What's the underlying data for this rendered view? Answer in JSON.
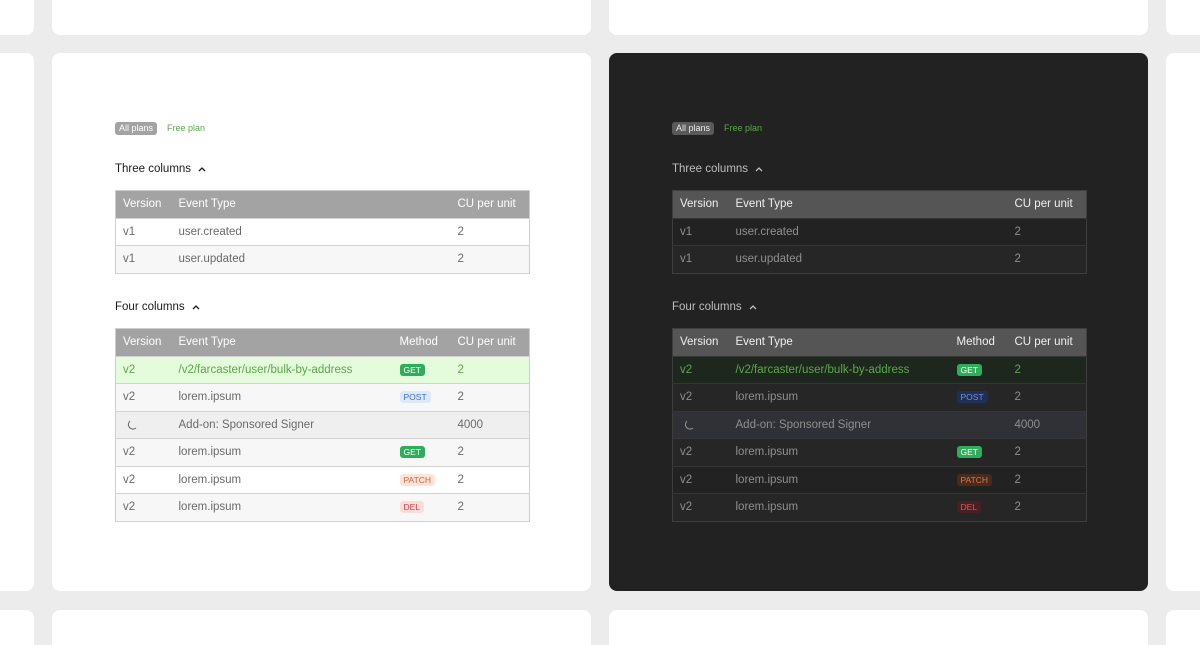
{
  "panels": [
    {
      "theme": "light",
      "tags": {
        "all_plans": "All plans",
        "free_plan": "Free plan"
      },
      "three_columns": {
        "title": "Three columns",
        "headers": [
          "Version",
          "Event Type",
          "CU per unit"
        ],
        "rows": [
          {
            "version": "v1",
            "event": "user.created",
            "cu": "2"
          },
          {
            "version": "v1",
            "event": "user.updated",
            "cu": "2"
          }
        ]
      },
      "four_columns": {
        "title": "Four columns",
        "headers": [
          "Version",
          "Event Type",
          "Method",
          "CU per unit"
        ],
        "rows": [
          {
            "version": "v2",
            "event": "/v2/farcaster/user/bulk-by-address",
            "method": "GET",
            "cu": "2"
          },
          {
            "version": "v2",
            "event": "lorem.ipsum",
            "method": "POST",
            "cu": "2"
          },
          {
            "version": "",
            "event": "Add-on: Sponsored Signer",
            "method": "",
            "cu": "4000"
          },
          {
            "version": "v2",
            "event": "lorem.ipsum",
            "method": "GET",
            "cu": "2"
          },
          {
            "version": "v2",
            "event": "lorem.ipsum",
            "method": "PATCH",
            "cu": "2"
          },
          {
            "version": "v2",
            "event": "lorem.ipsum",
            "method": "DEL",
            "cu": "2"
          }
        ]
      }
    },
    {
      "theme": "dark",
      "tags": {
        "all_plans": "All plans",
        "free_plan": "Free plan"
      },
      "three_columns": {
        "title": "Three columns",
        "headers": [
          "Version",
          "Event Type",
          "CU per unit"
        ],
        "rows": [
          {
            "version": "v1",
            "event": "user.created",
            "cu": "2"
          },
          {
            "version": "v1",
            "event": "user.updated",
            "cu": "2"
          }
        ]
      },
      "four_columns": {
        "title": "Four columns",
        "headers": [
          "Version",
          "Event Type",
          "Method",
          "CU per unit"
        ],
        "rows": [
          {
            "version": "v2",
            "event": "/v2/farcaster/user/bulk-by-address",
            "method": "GET",
            "cu": "2"
          },
          {
            "version": "v2",
            "event": "lorem.ipsum",
            "method": "POST",
            "cu": "2"
          },
          {
            "version": "",
            "event": "Add-on: Sponsored Signer",
            "method": "",
            "cu": "4000"
          },
          {
            "version": "v2",
            "event": "lorem.ipsum",
            "method": "GET",
            "cu": "2"
          },
          {
            "version": "v2",
            "event": "lorem.ipsum",
            "method": "PATCH",
            "cu": "2"
          },
          {
            "version": "v2",
            "event": "lorem.ipsum",
            "method": "DEL",
            "cu": "2"
          }
        ]
      }
    }
  ],
  "icons": {
    "collapse": "chevron-up-icon",
    "addon": "moon-icon"
  },
  "colors": {
    "accent_green": "#5aa84a",
    "get": "#2eae5b",
    "post": "#3a6fd6",
    "patch": "#d0633d",
    "del": "#d24242"
  }
}
